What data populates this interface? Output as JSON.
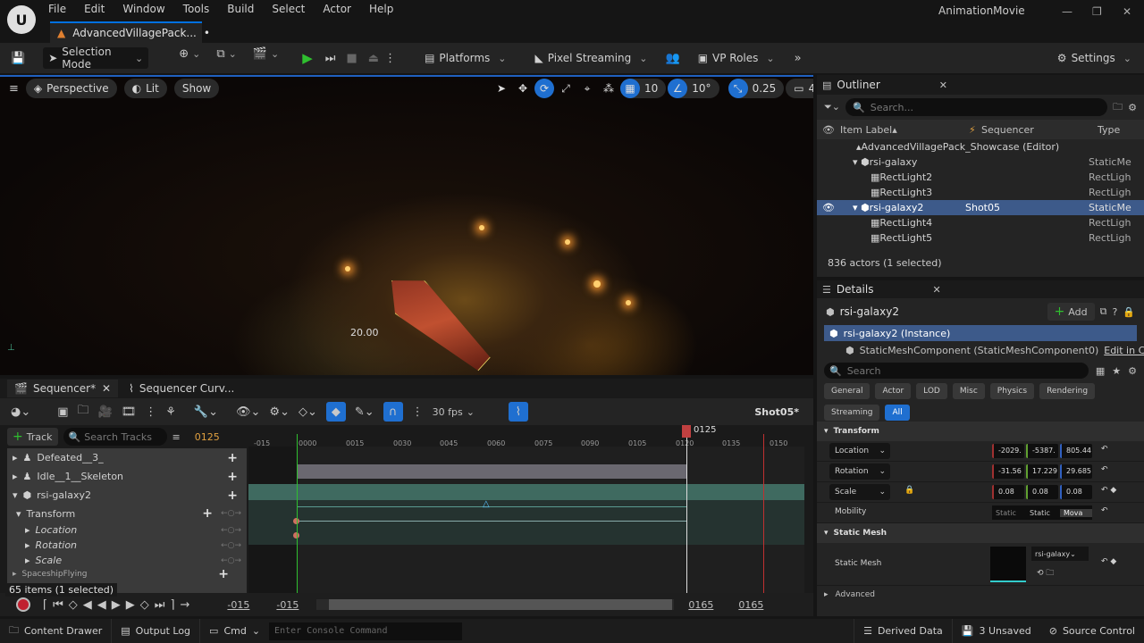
{
  "app": {
    "project": "AnimationMovie",
    "document_tab": "AdvancedVillagePack..."
  },
  "menu": [
    "File",
    "Edit",
    "Window",
    "Tools",
    "Build",
    "Select",
    "Actor",
    "Help"
  ],
  "toolbar": {
    "selection_mode": "Selection Mode",
    "platforms": "Platforms",
    "pixel_streaming": "Pixel Streaming",
    "vp_roles": "VP Roles",
    "settings": "Settings"
  },
  "viewport": {
    "perspective": "Perspective",
    "lit": "Lit",
    "show": "Show",
    "grid_snap": "10",
    "rotation_snap": "10°",
    "scale_snap": "0.25",
    "camera_speed": "4",
    "overlay_label": "20.00"
  },
  "sequencer": {
    "tab": "Sequencer*",
    "curve_tab": "Sequencer Curv...",
    "fps": "30 fps",
    "shot": "Shot05*",
    "track_button": "Track",
    "search_placeholder": "Search Tracks",
    "current_frame": "0125",
    "playhead_label": "0125",
    "ticks": [
      "-015",
      "0000",
      "0015",
      "0030",
      "0045",
      "0060",
      "0075",
      "0090",
      "0105",
      "0120",
      "0135",
      "0150"
    ],
    "tracks": [
      {
        "label": "Defeated__3_"
      },
      {
        "label": "Idle__1__Skeleton"
      },
      {
        "label": "rsi-galaxy2"
      },
      {
        "label": "Transform"
      },
      {
        "label": "Location"
      },
      {
        "label": "Rotation"
      },
      {
        "label": "Scale"
      },
      {
        "label": "SpaceshipFlying"
      }
    ],
    "items_count": "65 items (1 selected)",
    "range_start": "-015",
    "range_start2": "-015",
    "range_end": "0165",
    "range_end2": "0165"
  },
  "outliner": {
    "title": "Outliner",
    "search_placeholder": "Search...",
    "columns": [
      "Item Label",
      "Sequencer",
      "Type"
    ],
    "rows": [
      {
        "label": "AdvancedVillagePack_Showcase (Editor)",
        "seq": "",
        "type": ""
      },
      {
        "label": "rsi-galaxy",
        "seq": "",
        "type": "StaticMe"
      },
      {
        "label": "RectLight2",
        "seq": "",
        "type": "RectLigh"
      },
      {
        "label": "RectLight3",
        "seq": "",
        "type": "RectLigh"
      },
      {
        "label": "rsi-galaxy2",
        "seq": "Shot05",
        "type": "StaticMe"
      },
      {
        "label": "RectLight4",
        "seq": "",
        "type": "RectLigh"
      },
      {
        "label": "RectLight5",
        "seq": "",
        "type": "RectLigh"
      }
    ],
    "status": "836 actors (1 selected)"
  },
  "details": {
    "title": "Details",
    "actor": "rsi-galaxy2",
    "add": "Add",
    "instance": "rsi-galaxy2 (Instance)",
    "component": "StaticMeshComponent (StaticMeshComponent0)",
    "edit_link": "Edit in C+",
    "search_placeholder": "Search",
    "filters": [
      "General",
      "Actor",
      "LOD",
      "Misc",
      "Physics",
      "Rendering",
      "Streaming",
      "All"
    ],
    "transform": "Transform",
    "location": "Location",
    "location_values": [
      "-2029.",
      "-5387.",
      "805.44"
    ],
    "rotation": "Rotation",
    "rotation_values": [
      "-31.56",
      "17.229",
      "29.685"
    ],
    "scale": "Scale",
    "scale_values": [
      "0.08",
      "0.08",
      "0.08"
    ],
    "mobility": "Mobility",
    "mobility_options": [
      "Static",
      "Static",
      "Mova"
    ],
    "static_mesh_cat": "Static Mesh",
    "static_mesh": "Static Mesh",
    "mesh_value": "rsi-galaxy",
    "advanced": "Advanced"
  },
  "statusbar": {
    "content_drawer": "Content Drawer",
    "output_log": "Output Log",
    "cmd": "Cmd",
    "console_placeholder": "Enter Console Command",
    "derived_data": "Derived Data",
    "unsaved": "3 Unsaved",
    "source_control": "Source Control"
  },
  "colors": {
    "accent": "#1f6fd0",
    "playhead": "#c04040",
    "track_teal": "#3f6a60",
    "green": "#2fbf2f"
  }
}
